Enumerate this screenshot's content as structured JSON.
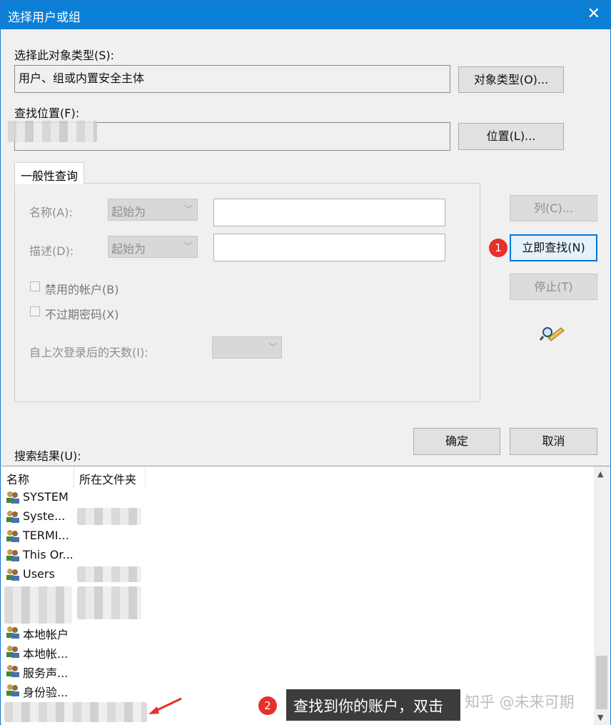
{
  "window": {
    "title": "选择用户或组",
    "close_glyph": "✕"
  },
  "object_type": {
    "label": "选择此对象类型(S):",
    "value": "用户、组或内置安全主体",
    "button": "对象类型(O)..."
  },
  "location": {
    "label": "查找位置(F):",
    "button": "位置(L)..."
  },
  "query": {
    "tab": "一般性查询",
    "name_label": "名称(A):",
    "name_op": "起始为",
    "desc_label": "描述(D):",
    "desc_op": "起始为",
    "disabled_accounts": "禁用的帐户(B)",
    "non_expiring": "不过期密码(X)",
    "days_label": "自上次登录后的天数(I):"
  },
  "side_buttons": {
    "columns": "列(C)...",
    "find_now": "立即查找(N)",
    "stop": "停止(T)"
  },
  "footer_buttons": {
    "ok": "确定",
    "cancel": "取消"
  },
  "results": {
    "label": "搜索结果(U):",
    "columns": [
      "名称",
      "所在文件夹"
    ],
    "rows": [
      "SYSTEM",
      "Syste...",
      "TERMI...",
      "This Or...",
      "Users",
      "",
      "",
      "本地帐户",
      "本地帐...",
      "服务声...",
      "身份验..."
    ]
  },
  "annotations": {
    "marker1": "1",
    "marker2": "2",
    "tip": "查找到你的账户，双击"
  },
  "watermark": "知乎 @未来可期",
  "colors": {
    "accent": "#0b7fd6",
    "marker": "#e5302d"
  }
}
